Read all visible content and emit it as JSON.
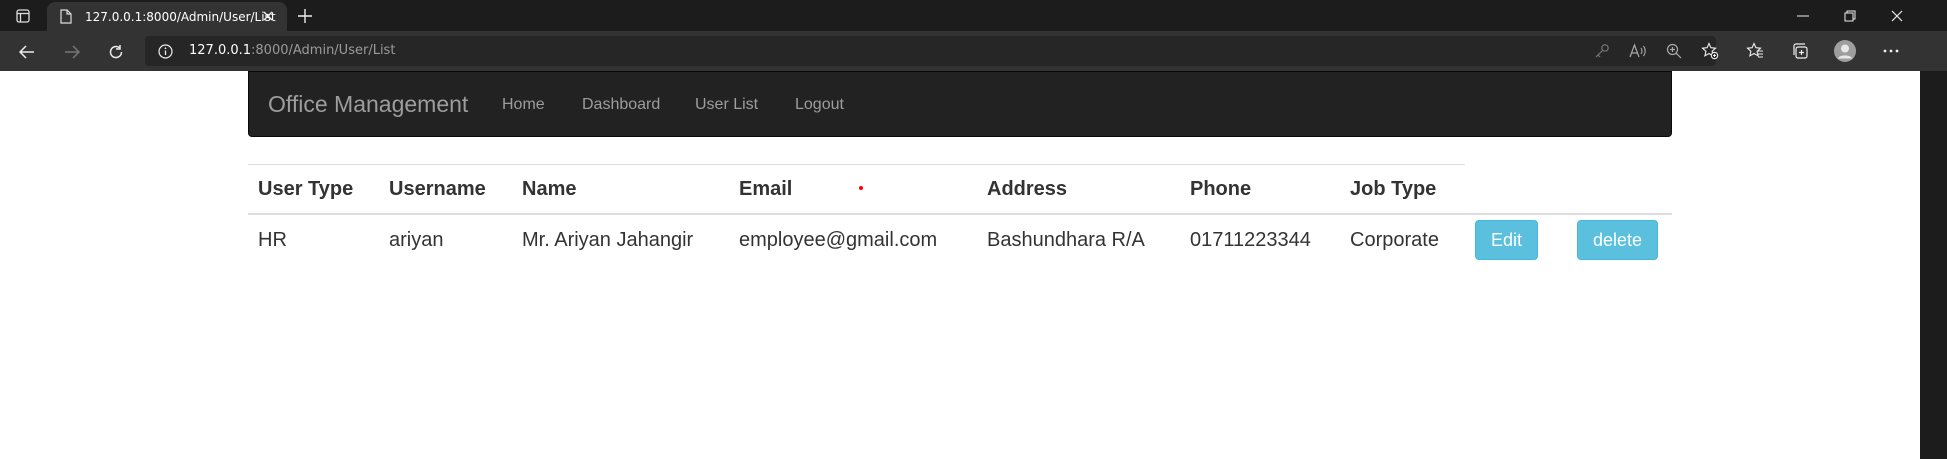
{
  "browser": {
    "tab_title": "127.0.0.1:8000/Admin/User/List",
    "url_host": "127.0.0.1",
    "url_rest": ":8000/Admin/User/List"
  },
  "navbar": {
    "brand": "Office Management",
    "links": [
      "Home",
      "Dashboard",
      "User List",
      "Logout"
    ]
  },
  "table": {
    "headers": [
      "User Type",
      "Username",
      "Name",
      "Email",
      "Address",
      "Phone",
      "Job Type"
    ],
    "rows": [
      {
        "cells": [
          "HR",
          "ariyan",
          "Mr. Ariyan Jahangir",
          "employee@gmail.com",
          "Bashundhara R/A",
          "01711223344",
          "Corporate"
        ],
        "edit_label": "Edit",
        "delete_label": "delete"
      }
    ]
  },
  "colors": {
    "navbar_bg": "#222222",
    "button_info": "#5bc0de",
    "browser_dark": "#1c1c1c"
  }
}
